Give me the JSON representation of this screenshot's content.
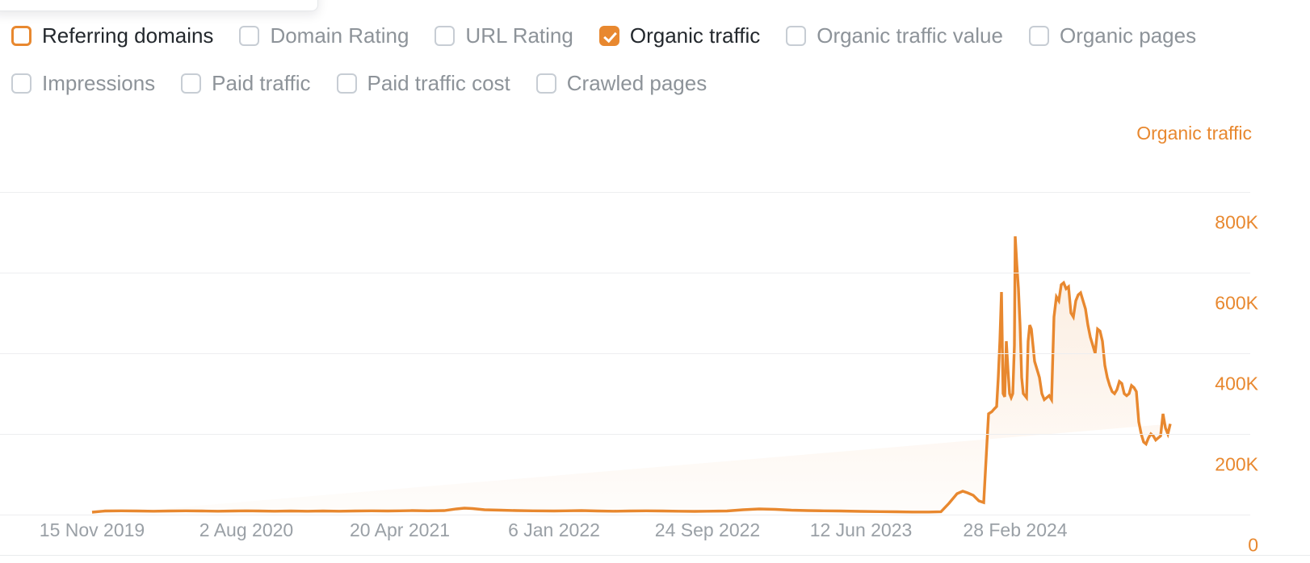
{
  "metrics": {
    "rows": [
      [
        {
          "label": "Referring domains",
          "checked": false,
          "accent": true
        },
        {
          "label": "Domain Rating",
          "checked": false,
          "accent": false
        },
        {
          "label": "URL Rating",
          "checked": false,
          "accent": false
        },
        {
          "label": "Organic traffic",
          "checked": true,
          "accent": false
        },
        {
          "label": "Organic traffic value",
          "checked": false,
          "accent": false
        },
        {
          "label": "Organic pages",
          "checked": false,
          "accent": false
        }
      ],
      [
        {
          "label": "Impressions",
          "checked": false,
          "accent": false
        },
        {
          "label": "Paid traffic",
          "checked": false,
          "accent": false
        },
        {
          "label": "Paid traffic cost",
          "checked": false,
          "accent": false
        },
        {
          "label": "Crawled pages",
          "checked": false,
          "accent": false
        }
      ]
    ]
  },
  "colors": {
    "accent": "#e8882f",
    "grid": "#edeef0",
    "axis_text": "#9aa0a6",
    "label_off": "#8d9399",
    "label_on": "#23282d"
  },
  "chart_data": {
    "type": "area",
    "title": "Organic traffic",
    "xlabel": "",
    "ylabel": "Organic traffic",
    "ylim": [
      0,
      900000
    ],
    "yticks": [
      800000,
      600000,
      400000,
      200000,
      0
    ],
    "ytick_labels": [
      "800K",
      "600K",
      "400K",
      "200K",
      "0"
    ],
    "grid": true,
    "legend_position": "top-right",
    "series_color": "#e8882f",
    "xtick_labels": [
      "15 Nov 2019",
      "2 Aug 2020",
      "20 Apr 2021",
      "6 Jan 2022",
      "24 Sep 2022",
      "12 Jun 2023",
      "28 Feb 2024"
    ],
    "xtick_positions": [
      114,
      305,
      495,
      686,
      876,
      1066,
      1257
    ],
    "x_start": 114,
    "x_end": 1452,
    "series": [
      {
        "name": "Organic traffic",
        "x": [
          114,
          130,
          150,
          170,
          190,
          210,
          230,
          250,
          270,
          290,
          305,
          320,
          340,
          360,
          380,
          400,
          420,
          440,
          460,
          480,
          495,
          510,
          530,
          550,
          565,
          575,
          585,
          600,
          620,
          640,
          660,
          686,
          700,
          720,
          740,
          760,
          780,
          800,
          820,
          840,
          860,
          876,
          900,
          920,
          940,
          960,
          980,
          1000,
          1020,
          1040,
          1066,
          1090,
          1110,
          1130,
          1150,
          1165,
          1175,
          1185,
          1192,
          1198,
          1205,
          1212,
          1218,
          1224,
          1228,
          1231,
          1234,
          1236,
          1238,
          1240,
          1242,
          1244,
          1246,
          1248,
          1250,
          1252,
          1254,
          1256,
          1257,
          1259,
          1261,
          1263,
          1265,
          1267,
          1269,
          1271,
          1273,
          1275,
          1277,
          1279,
          1281,
          1284,
          1287,
          1290,
          1293,
          1296,
          1299,
          1302,
          1305,
          1308,
          1311,
          1314,
          1317,
          1320,
          1323,
          1326,
          1329,
          1332,
          1335,
          1338,
          1341,
          1344,
          1347,
          1350,
          1353,
          1356,
          1359,
          1362,
          1365,
          1368,
          1371,
          1374,
          1377,
          1380,
          1383,
          1386,
          1389,
          1392,
          1395,
          1398,
          1401,
          1404,
          1407,
          1410,
          1413,
          1416,
          1419,
          1422,
          1425,
          1428,
          1431,
          1434,
          1437,
          1440,
          1443,
          1446,
          1449,
          1452
        ],
        "values": [
          6000,
          9000,
          9500,
          9000,
          8500,
          9000,
          9500,
          9000,
          8500,
          9000,
          9500,
          9000,
          8500,
          9000,
          8500,
          9000,
          8500,
          9000,
          9500,
          9000,
          9500,
          10000,
          9500,
          10000,
          14000,
          16000,
          15000,
          12000,
          11000,
          10000,
          9500,
          9000,
          9500,
          10000,
          9000,
          8500,
          9000,
          9500,
          9000,
          8500,
          8000,
          8500,
          9000,
          12000,
          14000,
          13000,
          11000,
          10000,
          9500,
          9000,
          8000,
          7500,
          7000,
          6500,
          6500,
          7000,
          28000,
          52000,
          58000,
          54000,
          48000,
          34000,
          30000,
          250000,
          255000,
          262000,
          268000,
          340000,
          430000,
          552000,
          300000,
          292000,
          430000,
          360000,
          300000,
          290000,
          300000,
          420000,
          690000,
          620000,
          560000,
          470000,
          340000,
          300000,
          295000,
          290000,
          430000,
          470000,
          460000,
          420000,
          380000,
          360000,
          340000,
          300000,
          285000,
          290000,
          295000,
          285000,
          490000,
          540000,
          530000,
          570000,
          575000,
          560000,
          565000,
          500000,
          490000,
          530000,
          545000,
          550000,
          530000,
          510000,
          470000,
          440000,
          420000,
          400000,
          460000,
          455000,
          430000,
          370000,
          340000,
          320000,
          305000,
          300000,
          310000,
          330000,
          325000,
          300000,
          295000,
          300000,
          320000,
          315000,
          305000,
          230000,
          200000,
          180000,
          175000,
          190000,
          200000,
          195000,
          185000,
          190000,
          195000,
          250000,
          215000,
          200000,
          225000
        ]
      }
    ]
  }
}
